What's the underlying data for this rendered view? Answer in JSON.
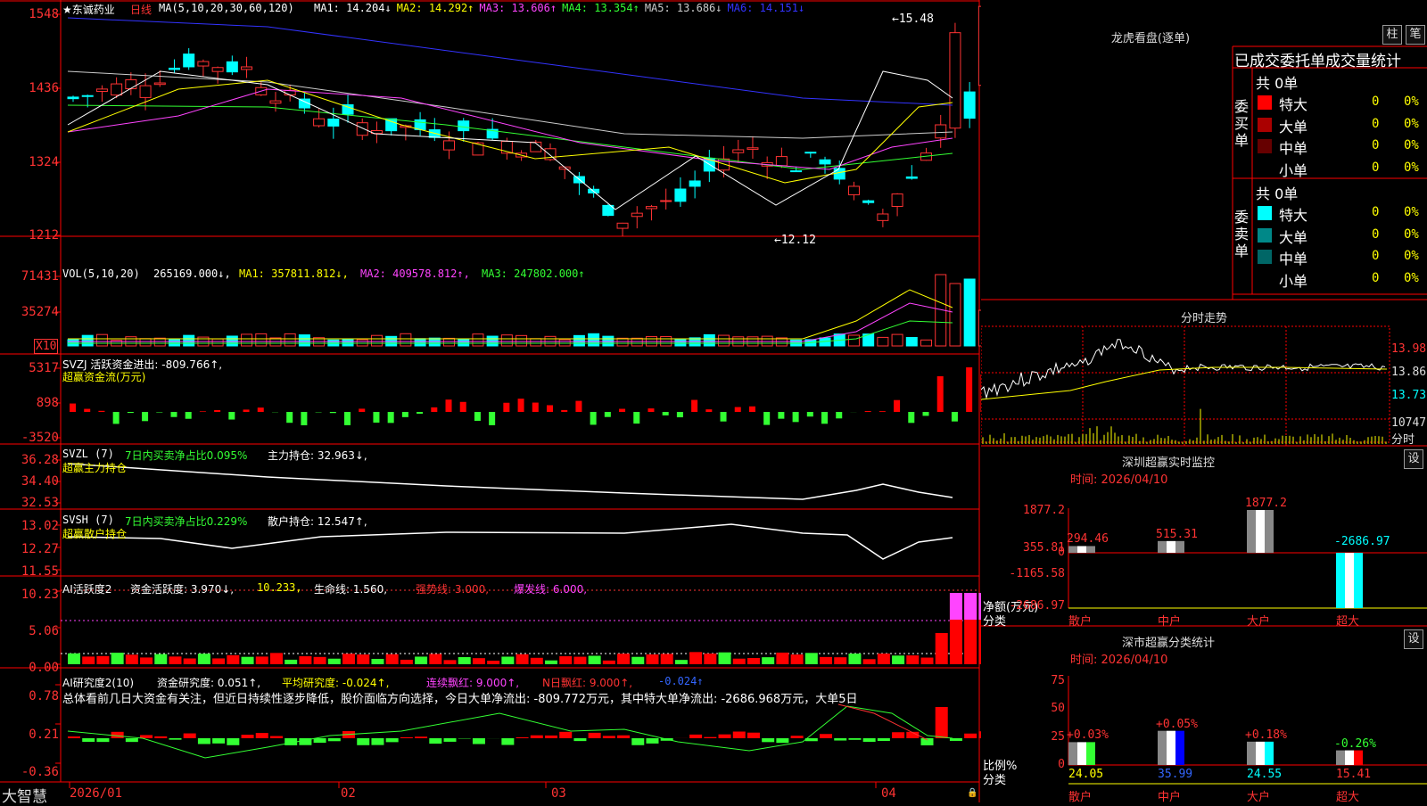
{
  "stock": {
    "name": "★东诚药业",
    "period": "日线"
  },
  "kline": {
    "ma_header": "MA(5,10,20,30,60,120)",
    "ma_values": [
      {
        "label": "MA1: 14.204↓",
        "color": "#ffffff"
      },
      {
        "label": "MA2: 14.292↑",
        "color": "#ffff00"
      },
      {
        "label": "MA3: 13.606↑",
        "color": "#ff44ff"
      },
      {
        "label": "MA4: 13.354↑",
        "color": "#33ff33"
      },
      {
        "label": "MA5: 13.686↓",
        "color": "#cccccc"
      },
      {
        "label": "MA6: 14.151↓",
        "color": "#3333ff"
      }
    ],
    "y_labels": [
      "1548",
      "1436",
      "1324",
      "1212"
    ],
    "high_mark": "←15.48",
    "low_mark": "←12.12"
  },
  "volume": {
    "header": "VOL(5,10,20)",
    "value": "265169.000↓,",
    "ma1": "MA1: 357811.812↓,",
    "ma2": "MA2: 409578.812↑,",
    "ma3": "MA3: 247802.000↑",
    "y_labels": [
      "71431",
      "35274"
    ],
    "multiplier": "X10"
  },
  "svzj": {
    "header": "SVZJ  活跃资金进出: -809.766↑,",
    "sub": "超赢资金流(万元)",
    "y_labels": [
      "5317",
      "898",
      "-3520"
    ]
  },
  "svzl": {
    "header": "SVZL (7)",
    "pct": "7日内买卖净占比0.095%",
    "hold": "主力持仓: 32.963↓,",
    "sub": "超赢主力持仓",
    "y_labels": [
      "36.28",
      "34.40",
      "32.53"
    ]
  },
  "svsh": {
    "header": "SVSH (7)",
    "pct": "7日内买卖净占比0.229%",
    "hold": "散户持仓: 12.547↑,",
    "sub": "超赢散户持仓",
    "y_labels": [
      "13.02",
      "12.27",
      "11.55"
    ]
  },
  "ai_active": {
    "header": "AI活跃度2",
    "a": "资金活跃度: 3.970↓,",
    "b": "10.233,",
    "c": "生命线: 1.560,",
    "d": "强势线: 3.000,",
    "e": "爆发线: 6.000,",
    "y_labels": [
      "10.23",
      "5.06",
      "0.00"
    ]
  },
  "ai_research": {
    "header": "AI研究度2(10)",
    "a": "资金研究度: 0.051↑,",
    "b": "平均研究度: -0.024↑,",
    "c": "连续飘红: 9.000↑,",
    "d": "N日飘红: 9.000↑,",
    "e": "-0.024↑",
    "comment": "总体看前几日大资金有关注，但近日持续性逐步降低，股价面临方向选择，今日大单净流出: -809.772万元，其中特大单净流出: -2686.968万元，大单5日",
    "y_labels": [
      "0.78",
      "0.21",
      "-0.36"
    ]
  },
  "x_axis": {
    "dates": [
      "2026/01",
      "02",
      "03",
      "04"
    ],
    "logo": "大智慧"
  },
  "longhu": {
    "title": "龙虎看盘(逐单)",
    "btn1": "柱",
    "btn2": "笔",
    "header": "已成交委托单成交量统计",
    "buy": {
      "label": "委买单",
      "total": "共 0单",
      "rows": [
        {
          "name": "特大",
          "value": "0",
          "pct": "0%",
          "color": "#ff0000"
        },
        {
          "name": "大单",
          "value": "0",
          "pct": "0%",
          "color": "#aa0000"
        },
        {
          "name": "中单",
          "value": "0",
          "pct": "0%",
          "color": "#660000"
        },
        {
          "name": "小单",
          "value": "0",
          "pct": "0%",
          "color": "#000000"
        }
      ]
    },
    "sell": {
      "label": "委卖单",
      "total": "共 0单",
      "rows": [
        {
          "name": "特大",
          "value": "0",
          "pct": "0%",
          "color": "#00ffff"
        },
        {
          "name": "大单",
          "value": "0",
          "pct": "0%",
          "color": "#008888"
        },
        {
          "name": "中单",
          "value": "0",
          "pct": "0%",
          "color": "#006666"
        },
        {
          "name": "小单",
          "value": "0",
          "pct": "0%",
          "color": "#000000"
        }
      ]
    }
  },
  "intraday": {
    "title": "分时走势",
    "price_labels": [
      "13.98",
      "13.86",
      "13.73"
    ],
    "vol_label": "10747",
    "vol_caption": "分时"
  },
  "monitor": {
    "title": "深圳超赢实时监控",
    "btn": "设",
    "time": "时间: 2026/04/10",
    "y_labels": [
      "1877.2",
      "355.81",
      "0",
      "-1165.58",
      "-2686.97"
    ],
    "unit": "净额(万元)",
    "cat_caption": "分类",
    "categories": [
      "散户",
      "中户",
      "大户",
      "超大"
    ],
    "values": [
      294.46,
      515.31,
      1877.2,
      -2686.97
    ],
    "value_labels": [
      "294.46",
      "515.31",
      "1877.2",
      "-2686.97"
    ]
  },
  "classify": {
    "title": "深市超赢分类统计",
    "btn": "设",
    "time": "时间: 2026/04/10",
    "y_labels": [
      "75",
      "50",
      "25",
      "0"
    ],
    "unit": "比例%",
    "cat_caption": "分类",
    "categories": [
      "散户",
      "中户",
      "大户",
      "超大"
    ],
    "values": [
      24.05,
      35.99,
      24.55,
      15.41
    ],
    "value_labels": [
      "24.05",
      "35.99",
      "24.55",
      "15.41"
    ],
    "changes": [
      "+0.03%",
      "+0.05%",
      "+0.18%",
      "-0.26%"
    ]
  }
}
